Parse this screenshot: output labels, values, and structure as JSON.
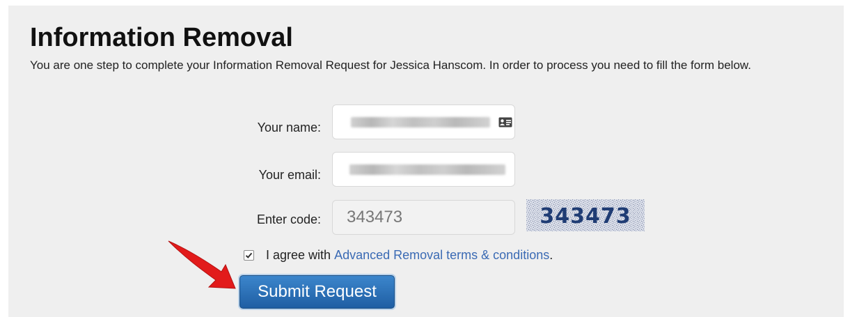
{
  "header": {
    "title": "Information Removal",
    "intro": "You are one step to complete your Information Removal Request for Jessica Hanscom. In order to process you need to fill the form below."
  },
  "form": {
    "name_label": "Your name:",
    "email_label": "Your email:",
    "code_label": "Enter code:",
    "code_value": "343473",
    "captcha_text": "343473",
    "agree_checked": true,
    "agree_text": "I agree with",
    "terms_link": "Advanced Removal terms & conditions",
    "agree_suffix": ".",
    "submit_label": "Submit Request"
  },
  "icons": {
    "name_field_icon": "contact-card-icon",
    "annotation": "red-arrow-icon"
  },
  "colors": {
    "panel_bg": "#efefef",
    "link": "#3a6ab4",
    "button": "#2a6fb8",
    "arrow": "#e21b1b",
    "captcha_text": "#1f3c74"
  }
}
